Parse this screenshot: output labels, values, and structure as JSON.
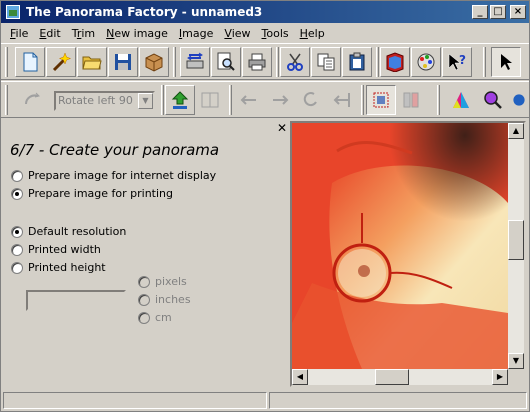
{
  "window": {
    "title": "The Panorama Factory - unnamed3",
    "controls": {
      "minimize": "_",
      "maximize": "□",
      "close": "×"
    }
  },
  "menu": [
    {
      "label": "File",
      "mnemonic": "F",
      "rest": "ile"
    },
    {
      "label": "Edit",
      "mnemonic": "E",
      "rest": "dit"
    },
    {
      "label": "Trim",
      "mnemonic": "r",
      "pre": "T",
      "rest": "im"
    },
    {
      "label": "New image",
      "mnemonic": "N",
      "rest": "ew image"
    },
    {
      "label": "Image",
      "mnemonic": "I",
      "rest": "mage"
    },
    {
      "label": "View",
      "mnemonic": "V",
      "rest": "iew"
    },
    {
      "label": "Tools",
      "mnemonic": "T",
      "rest": "ools"
    },
    {
      "label": "Help",
      "mnemonic": "H",
      "rest": "elp"
    }
  ],
  "toolbar1": {
    "buttons": [
      "new-document",
      "wizard",
      "open-folder",
      "save-disk",
      "package",
      "scan",
      "print-preview",
      "print",
      "cut",
      "copy",
      "paste",
      "help-book",
      "color-palette",
      "context-help",
      "pointer"
    ]
  },
  "toolbar2": {
    "rotate_select": {
      "value": "Rotate left 90",
      "disabled": true
    },
    "buttons": [
      "rotate-tool",
      "upload",
      "frames",
      "align-left",
      "align-right",
      "rotate-ccw",
      "stitch",
      "crop",
      "page-split",
      "color-balance",
      "zoom-color",
      "extra"
    ]
  },
  "panel": {
    "close_label": "✕",
    "heading": "6/7 - Create your panorama",
    "output_options": [
      {
        "label": "Prepare image for internet display",
        "checked": false
      },
      {
        "label": "Prepare image for printing",
        "checked": true
      }
    ],
    "resolution_options": [
      {
        "label": "Default resolution",
        "checked": true
      },
      {
        "label": "Printed width",
        "checked": false
      },
      {
        "label": "Printed height",
        "checked": false
      }
    ],
    "size_input": {
      "value": ""
    },
    "unit_options": [
      {
        "label": "pixels",
        "disabled": true
      },
      {
        "label": "inches",
        "disabled": true
      },
      {
        "label": "cm",
        "disabled": true
      }
    ]
  },
  "preview": {
    "scroll_up": "▲",
    "scroll_down": "▼",
    "scroll_left": "◀",
    "scroll_right": "▶"
  },
  "status": {
    "cells": [
      "",
      ""
    ]
  },
  "colors": {
    "title_start": "#0a246a",
    "title_end": "#3a6ea5",
    "face": "#d4d0c8",
    "photo_red": "#e8452a",
    "photo_skin": "#f5e6b8"
  }
}
